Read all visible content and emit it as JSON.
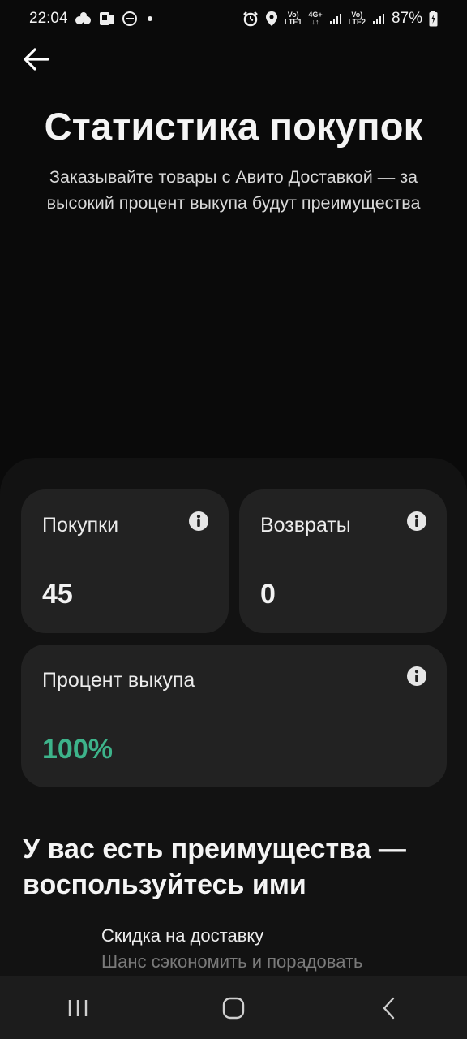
{
  "status_bar": {
    "time": "22:04",
    "battery": "87%",
    "sim1_top": "Vo)",
    "sim1_bottom": "LTE1",
    "net_top": "4G+",
    "sim2_top": "Vo)",
    "sim2_bottom": "LTE2",
    "icons_left": [
      "cloud-dots-icon",
      "sim-card-icon",
      "dnd-icon",
      "dot-icon"
    ],
    "icons_right": [
      "alarm-icon",
      "location-icon",
      "signal-icon",
      "battery-icon"
    ]
  },
  "header": {
    "back_icon": "arrow-left-icon",
    "title": "Статистика покупок",
    "subtitle": "Заказывайте товары с Авито Доставкой — за высокий процент выкупа будут преимущества"
  },
  "stats": {
    "purchases": {
      "label": "Покупки",
      "value": "45",
      "icon": "info-icon"
    },
    "returns": {
      "label": "Возвраты",
      "value": "0",
      "icon": "info-icon"
    },
    "buyout": {
      "label": "Процент выкупа",
      "value": "100%",
      "icon": "info-icon"
    }
  },
  "colors": {
    "accent_green": "#3db38a",
    "card_bg": "#222222",
    "sheet_bg": "#121212"
  },
  "benefits": {
    "title": "У вас есть преимущества — воспользуйтесь ими",
    "items": [
      {
        "title": "Скидка на доставку",
        "description": "Шанс сэкономить и порадовать"
      }
    ]
  },
  "nav": {
    "recents_icon": "recents-icon",
    "home_icon": "home-icon",
    "back_icon": "back-chevron-icon"
  }
}
